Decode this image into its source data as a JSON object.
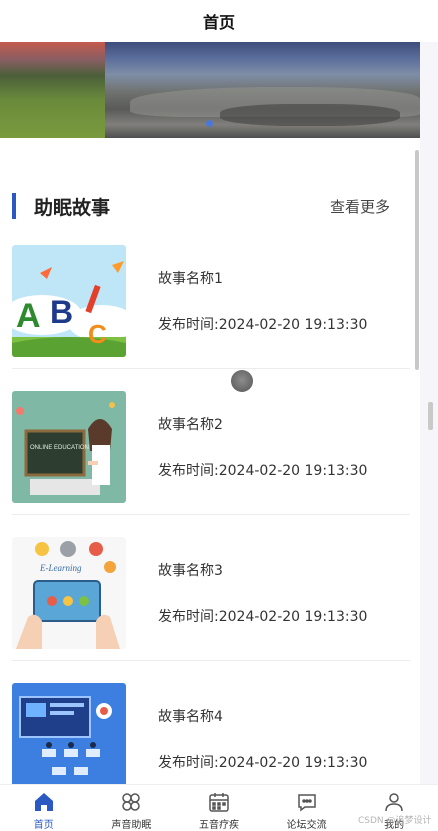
{
  "header": {
    "title": "首页"
  },
  "section": {
    "title": "助眠故事",
    "more_label": "查看更多"
  },
  "stories": [
    {
      "name": "故事名称1",
      "time": "发布时间:2024-02-20 19:13:30"
    },
    {
      "name": "故事名称2",
      "time": "发布时间:2024-02-20 19:13:30"
    },
    {
      "name": "故事名称3",
      "time": "发布时间:2024-02-20 19:13:30"
    },
    {
      "name": "故事名称4",
      "time": "发布时间:2024-02-20 19:13:30"
    }
  ],
  "thumbs": {
    "abc": {
      "a": "A",
      "b": "B",
      "c": "C"
    },
    "education": {
      "board": "ONLINE EDUCATION"
    },
    "elearning": {
      "text": "E-Learning"
    }
  },
  "tabbar": {
    "active_color": "#2b59c3",
    "items": [
      {
        "label": "首页",
        "icon": "home-icon"
      },
      {
        "label": "声音助眠",
        "icon": "flower-icon"
      },
      {
        "label": "五音疗疾",
        "icon": "calendar-icon"
      },
      {
        "label": "论坛交流",
        "icon": "chat-icon"
      },
      {
        "label": "我的",
        "icon": "user-icon"
      }
    ]
  },
  "watermark": "CSDN @追梦设计"
}
